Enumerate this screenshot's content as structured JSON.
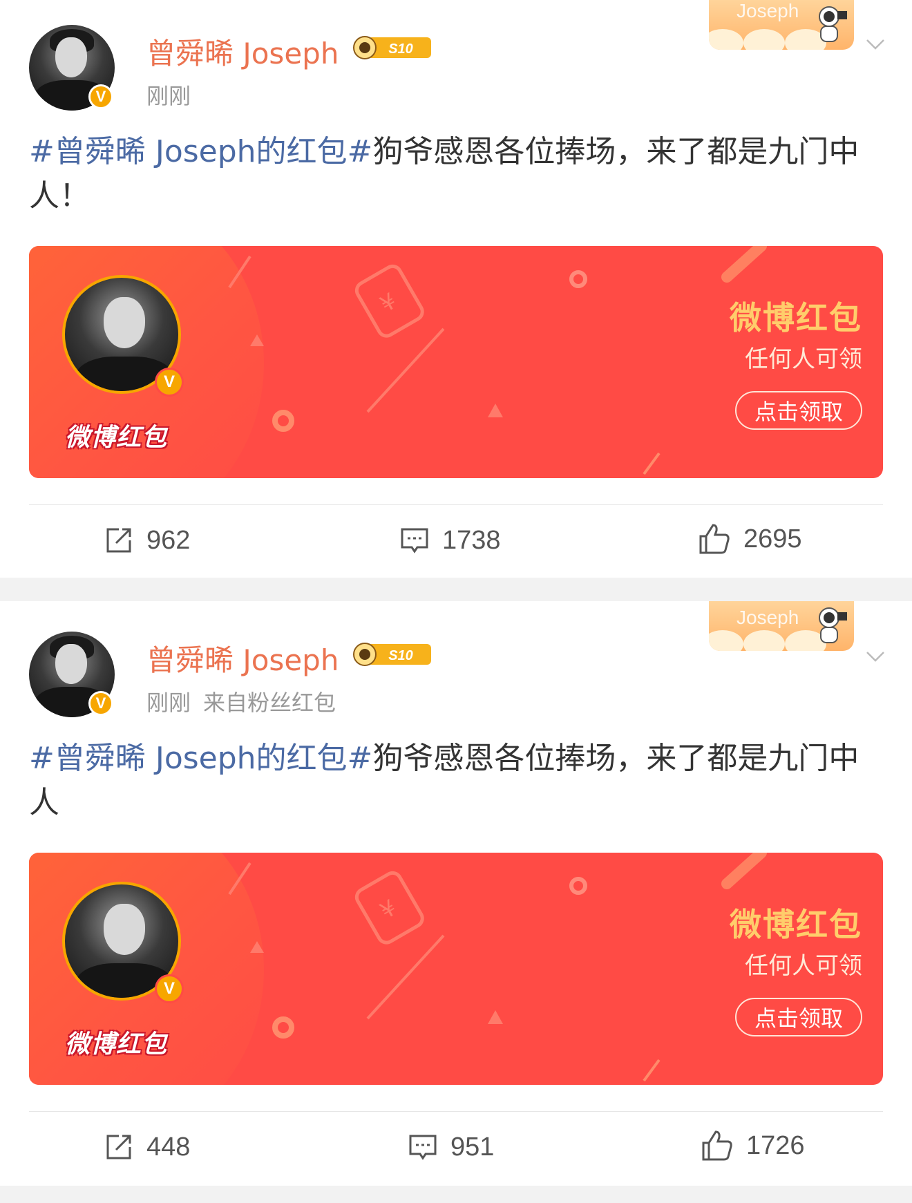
{
  "posts": [
    {
      "username": "曾舜晞 Joseph",
      "level_badge": "S10",
      "banner_text": "Joseph",
      "time": "刚刚",
      "source": "",
      "hashtag": "#曾舜晞 Joseph的红包#",
      "text": "狗爷感恩各位捧场，来了都是九门中人！",
      "card": {
        "logo": "微博红包",
        "title": "微博红包",
        "subtitle": "任何人可领",
        "button": "点击领取"
      },
      "reposts": "962",
      "comments": "1738",
      "likes": "2695"
    },
    {
      "username": "曾舜晞 Joseph",
      "level_badge": "S10",
      "banner_text": "Joseph",
      "time": "刚刚",
      "source": "来自粉丝红包",
      "hashtag": "#曾舜晞 Joseph的红包#",
      "text": "狗爷感恩各位捧场，来了都是九门中人",
      "card": {
        "logo": "微博红包",
        "title": "微博红包",
        "subtitle": "任何人可领",
        "button": "点击领取"
      },
      "reposts": "448",
      "comments": "951",
      "likes": "1726"
    }
  ],
  "icons": {
    "verified": "V",
    "repost": "repost-icon",
    "comment": "comment-icon",
    "like": "like-icon",
    "more": "chevron-down-icon"
  },
  "colors": {
    "username": "#eb7350",
    "hashtag": "#4b6aa4",
    "card_red": "#ff4b45",
    "card_title": "#ffcd6b",
    "verified": "#f7a600"
  }
}
